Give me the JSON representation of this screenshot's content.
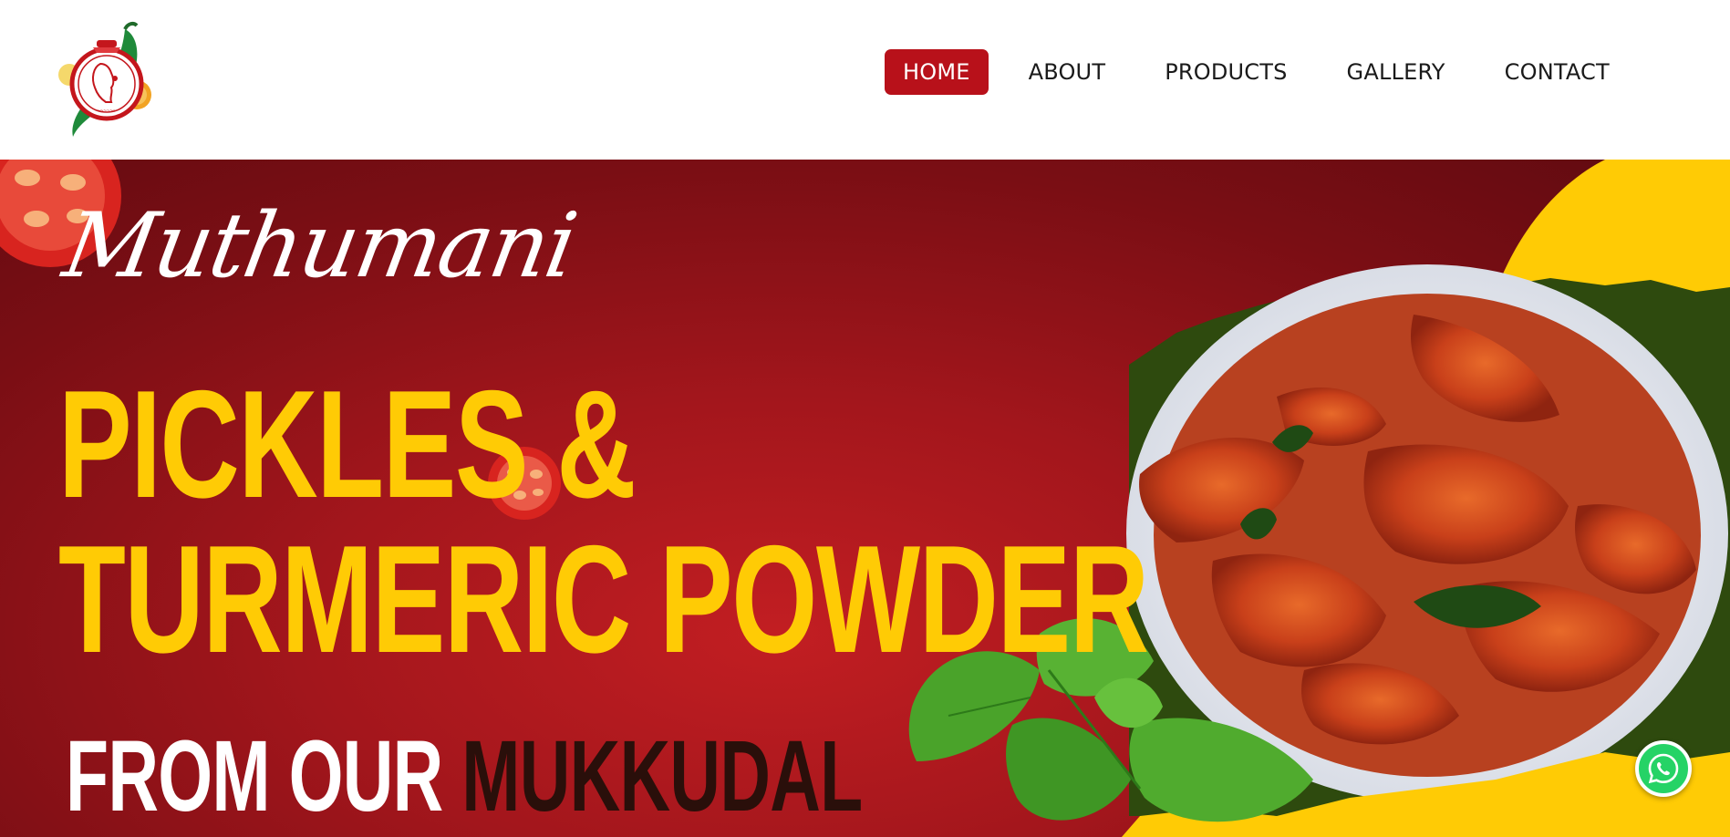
{
  "header": {
    "logo_icon": "brand-logo-icon",
    "nav": [
      {
        "label": "HOME",
        "active": true
      },
      {
        "label": "ABOUT",
        "active": false
      },
      {
        "label": "PRODUCTS",
        "active": false
      },
      {
        "label": "GALLERY",
        "active": false
      },
      {
        "label": "CONTACT",
        "active": false
      }
    ]
  },
  "hero": {
    "brand_script": "Muthumani",
    "headline_line1": "PICKLES &",
    "headline_line2": "TURMERIC POWDER",
    "subline_part1": "FROM OUR ",
    "subline_part2": "MUKKUDAL"
  },
  "floating": {
    "whatsapp_icon": "whatsapp-icon"
  },
  "colors": {
    "accent_red": "#b8111a",
    "headline_yellow": "#ffcb05",
    "hero_red": "#a3161c",
    "whatsapp_green": "#25d366"
  }
}
